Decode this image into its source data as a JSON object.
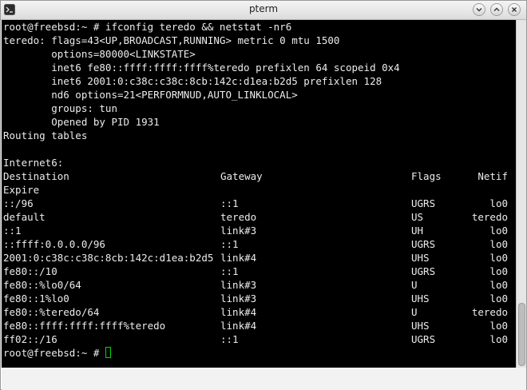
{
  "window": {
    "title": "pterm",
    "app_icon": "terminal-icon",
    "controls": {
      "minimize_icon": "chevron-down-icon",
      "maximize_icon": "chevron-up-icon",
      "close_icon": "close-icon"
    }
  },
  "terminal": {
    "background": "#000000",
    "foreground": "#ececec",
    "cursor_color": "#00dd00",
    "lines_top": [
      "root@freebsd:~ # ifconfig teredo && netstat -nr6",
      "teredo: flags=43<UP,BROADCAST,RUNNING> metric 0 mtu 1500",
      "        options=80000<LINKSTATE>",
      "        inet6 fe80::ffff:ffff:ffff%teredo prefixlen 64 scopeid 0x4",
      "        inet6 2001:0:c38c:c38c:8cb:142c:d1ea:b2d5 prefixlen 128",
      "        nd6 options=21<PERFORMNUD,AUTO_LINKLOCAL>",
      "        groups: tun",
      "        Opened by PID 1931",
      "Routing tables",
      "",
      "Internet6:"
    ],
    "table_header": {
      "destination": "Destination",
      "gateway": "Gateway",
      "flags": "Flags",
      "netif": "Netif",
      "expire": "Expire"
    },
    "routes": [
      {
        "destination": "::/96",
        "gateway": "::1",
        "flags": "UGRS",
        "netif": "lo0"
      },
      {
        "destination": "default",
        "gateway": "teredo",
        "flags": "US",
        "netif": "teredo"
      },
      {
        "destination": "::1",
        "gateway": "link#3",
        "flags": "UH",
        "netif": "lo0"
      },
      {
        "destination": "::ffff:0.0.0.0/96",
        "gateway": "::1",
        "flags": "UGRS",
        "netif": "lo0"
      },
      {
        "destination": "2001:0:c38c:c38c:8cb:142c:d1ea:b2d5",
        "gateway": "link#4",
        "flags": "UHS",
        "netif": "lo0"
      },
      {
        "destination": "fe80::/10",
        "gateway": "::1",
        "flags": "UGRS",
        "netif": "lo0"
      },
      {
        "destination": "fe80::%lo0/64",
        "gateway": "link#3",
        "flags": "U",
        "netif": "lo0"
      },
      {
        "destination": "fe80::1%lo0",
        "gateway": "link#3",
        "flags": "UHS",
        "netif": "lo0"
      },
      {
        "destination": "fe80::%teredo/64",
        "gateway": "link#4",
        "flags": "U",
        "netif": "teredo"
      },
      {
        "destination": "fe80::ffff:ffff:ffff%teredo",
        "gateway": "link#4",
        "flags": "UHS",
        "netif": "lo0"
      },
      {
        "destination": "ff02::/16",
        "gateway": "::1",
        "flags": "UGRS",
        "netif": "lo0"
      }
    ],
    "prompt": "root@freebsd:~ # "
  }
}
